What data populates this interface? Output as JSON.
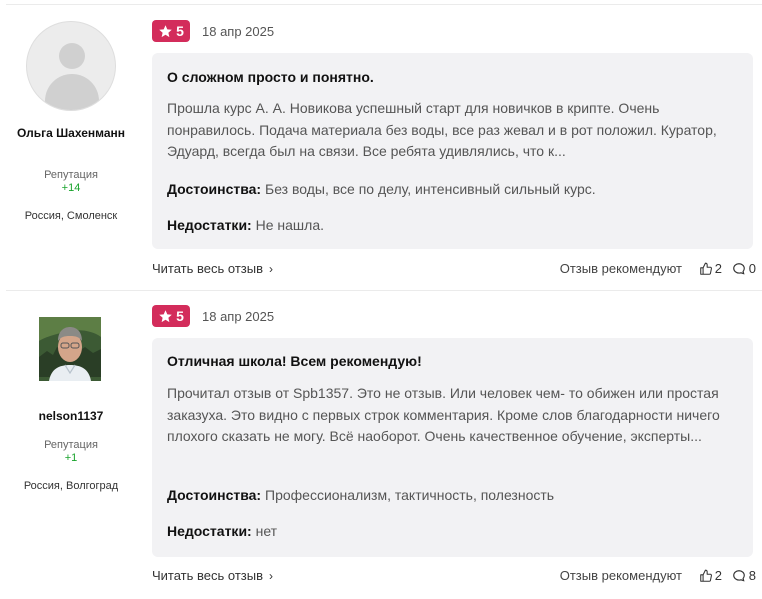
{
  "reviews": [
    {
      "author": "Ольга Шахенманн",
      "reputation_label": "Репутация",
      "reputation_value": "+14",
      "city": "Россия, Смоленск",
      "rating": "5",
      "date": "18 апр 2025",
      "title": "О сложном просто и понятно.",
      "text": "Прошла курс А. А. Новикова успешный старт для новичков в крипте. Очень понравилось. Подача материала без воды, все раз жевал и в рот положил. Куратор, Эдуард, всегда был на связи. Все ребята удивлялись, что к...",
      "pros_label": "Достоинства:",
      "pros": "Без воды, все по делу, интенсивный сильный курс.",
      "cons_label": "Недостатки:",
      "cons": "Не нашла.",
      "read_more": "Читать весь отзыв",
      "recommend_label": "Отзыв рекомендуют",
      "likes": "2",
      "comments": "0"
    },
    {
      "author": "nelson1137",
      "reputation_label": "Репутация",
      "reputation_value": "+1",
      "city": "Россия, Волгоград",
      "rating": "5",
      "date": "18 апр 2025",
      "title": "Отличная школа! Всем рекомендую!",
      "text": "Прочитал отзыв от Spb1357. Это не отзыв. Или человек чем- то обижен или простая заказуха. Это видно с первых строк комментария. Кроме слов благодарности ничего плохого сказать не могу. Всё наоборот. Очень качественное обучение, эксперты...",
      "pros_label": "Достоинства:",
      "pros": "Профессионализм, тактичность, полезность",
      "cons_label": "Недостатки:",
      "cons": "нет",
      "read_more": "Читать весь отзыв",
      "recommend_label": "Отзыв рекомендуют",
      "likes": "2",
      "comments": "8"
    }
  ],
  "icons": {
    "star": "star-icon",
    "like": "thumbs-up-icon",
    "comment": "comment-icon",
    "chevron": "chevron-right-icon"
  },
  "colors": {
    "rating_badge": "#d32c5b",
    "reputation": "#17a32b",
    "card_bg": "#f2f2f4"
  }
}
